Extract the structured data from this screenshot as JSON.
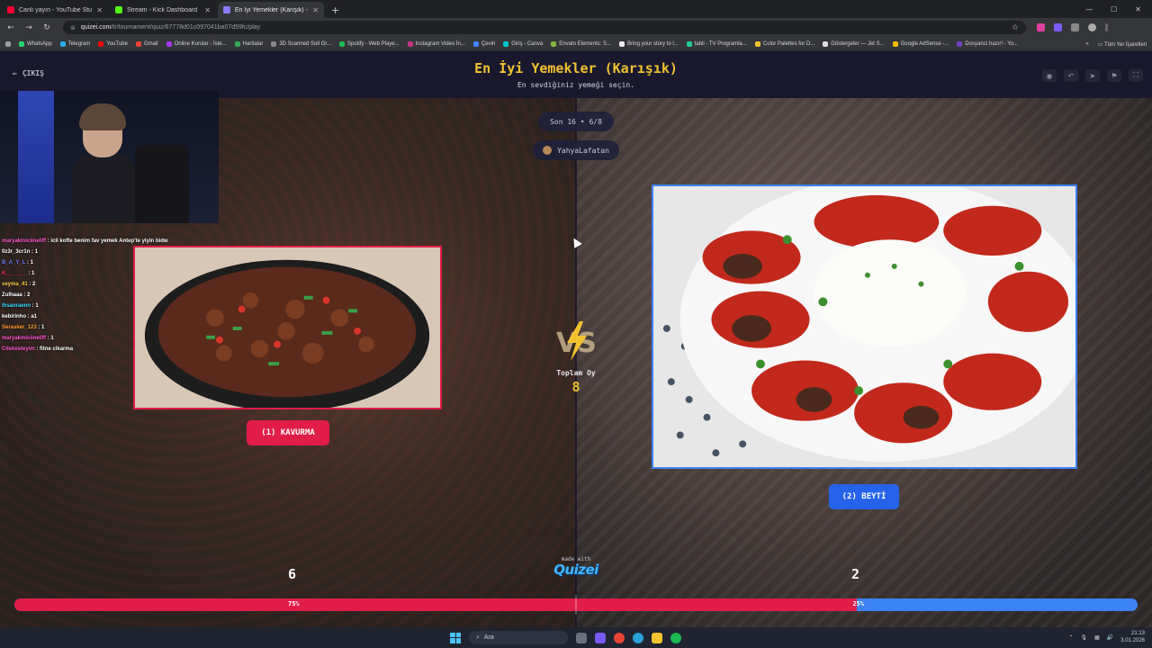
{
  "browser": {
    "tabs": [
      {
        "title": "Canlı yayın - YouTube Studio",
        "color": "#ff0033"
      },
      {
        "title": "Stream - Kick Dashboard",
        "color": "#53fc18"
      },
      {
        "title": "En İyi Yemekler (Karışık) - Tier l",
        "color": "#8a7dff",
        "active": true
      }
    ],
    "new_tab": "+",
    "url_host": "quizei.com",
    "url_path": "/tr/tournament/quiz/67778d01c097041ba07d59fc/play",
    "bookmarks": [
      {
        "label": "WhatsApp",
        "color": "#25d366"
      },
      {
        "label": "Telegram",
        "color": "#2aabee"
      },
      {
        "label": "YouTube",
        "color": "#ff0000"
      },
      {
        "label": "Gmail",
        "color": "#ea4335"
      },
      {
        "label": "Online Kurslar - İste...",
        "color": "#a435f0"
      },
      {
        "label": "Haritalar",
        "color": "#34a853"
      },
      {
        "label": "3D Scanned Soil Gr...",
        "color": "#888888"
      },
      {
        "label": "Spotify - Web Playe...",
        "color": "#1db954"
      },
      {
        "label": "Instagram Video İn...",
        "color": "#c13584"
      },
      {
        "label": "Çeviri",
        "color": "#4285f4"
      },
      {
        "label": "Giriş - Canva",
        "color": "#00c4cc"
      },
      {
        "label": "Envato Elements: S...",
        "color": "#82b541"
      },
      {
        "label": "Bring your story to l...",
        "color": "#eeeeee"
      },
      {
        "label": "tabii - TV Programla...",
        "color": "#20c997"
      },
      {
        "label": "Color Palettes for D...",
        "color": "#f2c230"
      },
      {
        "label": "Göstergeler — Jet S...",
        "color": "#dddddd"
      },
      {
        "label": "Google AdSense -...",
        "color": "#fbbc04"
      },
      {
        "label": "Dosyanız hazır! - Yo...",
        "color": "#6f42c1"
      }
    ],
    "bookmarks_more": "»",
    "all_bookmarks": "Tüm Yer İşaretleri"
  },
  "header": {
    "back_label": "ÇIKIŞ",
    "title": "En İyi Yemekler (Karışık)",
    "subtitle": "En sevdiğiniz yemeği seçin."
  },
  "round": {
    "label": "Son 16 • 6/8",
    "user": "YahyaLafatan"
  },
  "chat": [
    {
      "user": "maryakmiciineliff",
      "user_color": "#ff5ad6",
      "text": " : icli kofte benim fav yemek Antep'te yiyin bidw"
    },
    {
      "user": "0z3r_3cr1n",
      "user_color": "#ffffff",
      "text": " : 1"
    },
    {
      "user": "B_A_Y_L",
      "user_color": "#6f7dff",
      "text": " : 1"
    },
    {
      "user": "K_______",
      "user_color": "#ff3355",
      "text": " : 1"
    },
    {
      "user": "seyma_41",
      "user_color": "#ffd23f",
      "text": " : 2"
    },
    {
      "user": "Zulhaaa",
      "user_color": "#ffffff",
      "text": " : 2"
    },
    {
      "user": "ihsanraenn",
      "user_color": "#35e2ff",
      "text": " : 1"
    },
    {
      "user": "kebirinho",
      "user_color": "#ffffff",
      "text": " : a1"
    },
    {
      "user": "Serasker_123",
      "user_color": "#ff9f2e",
      "text": " : 1"
    },
    {
      "user": "maryakmiciineliff",
      "user_color": "#ff5ad6",
      "text": " : 1"
    },
    {
      "user": "Cilekesteyim",
      "user_color": "#ff5ad6",
      "text": " : fitne cikarma"
    }
  ],
  "choices": {
    "left": {
      "label": "(1) KAVURMA",
      "votes": "6",
      "percent_label": "75%",
      "percent": 75,
      "color": "#e11d48"
    },
    "right": {
      "label": "(2) BEYTİ",
      "votes": "2",
      "percent_label": "25%",
      "percent": 25,
      "color": "#2563eb"
    }
  },
  "vs_label": "VS",
  "total": {
    "label": "Toplam Oy",
    "value": "8"
  },
  "branding": {
    "made_with": "made with",
    "name": "Quizei"
  },
  "taskbar": {
    "search_placeholder": "Ara",
    "time": "21:13",
    "date": "3.01.2026"
  },
  "colors": {
    "accent_gold": "#f2c230",
    "left": "#e11d48",
    "right": "#3b82f6"
  }
}
